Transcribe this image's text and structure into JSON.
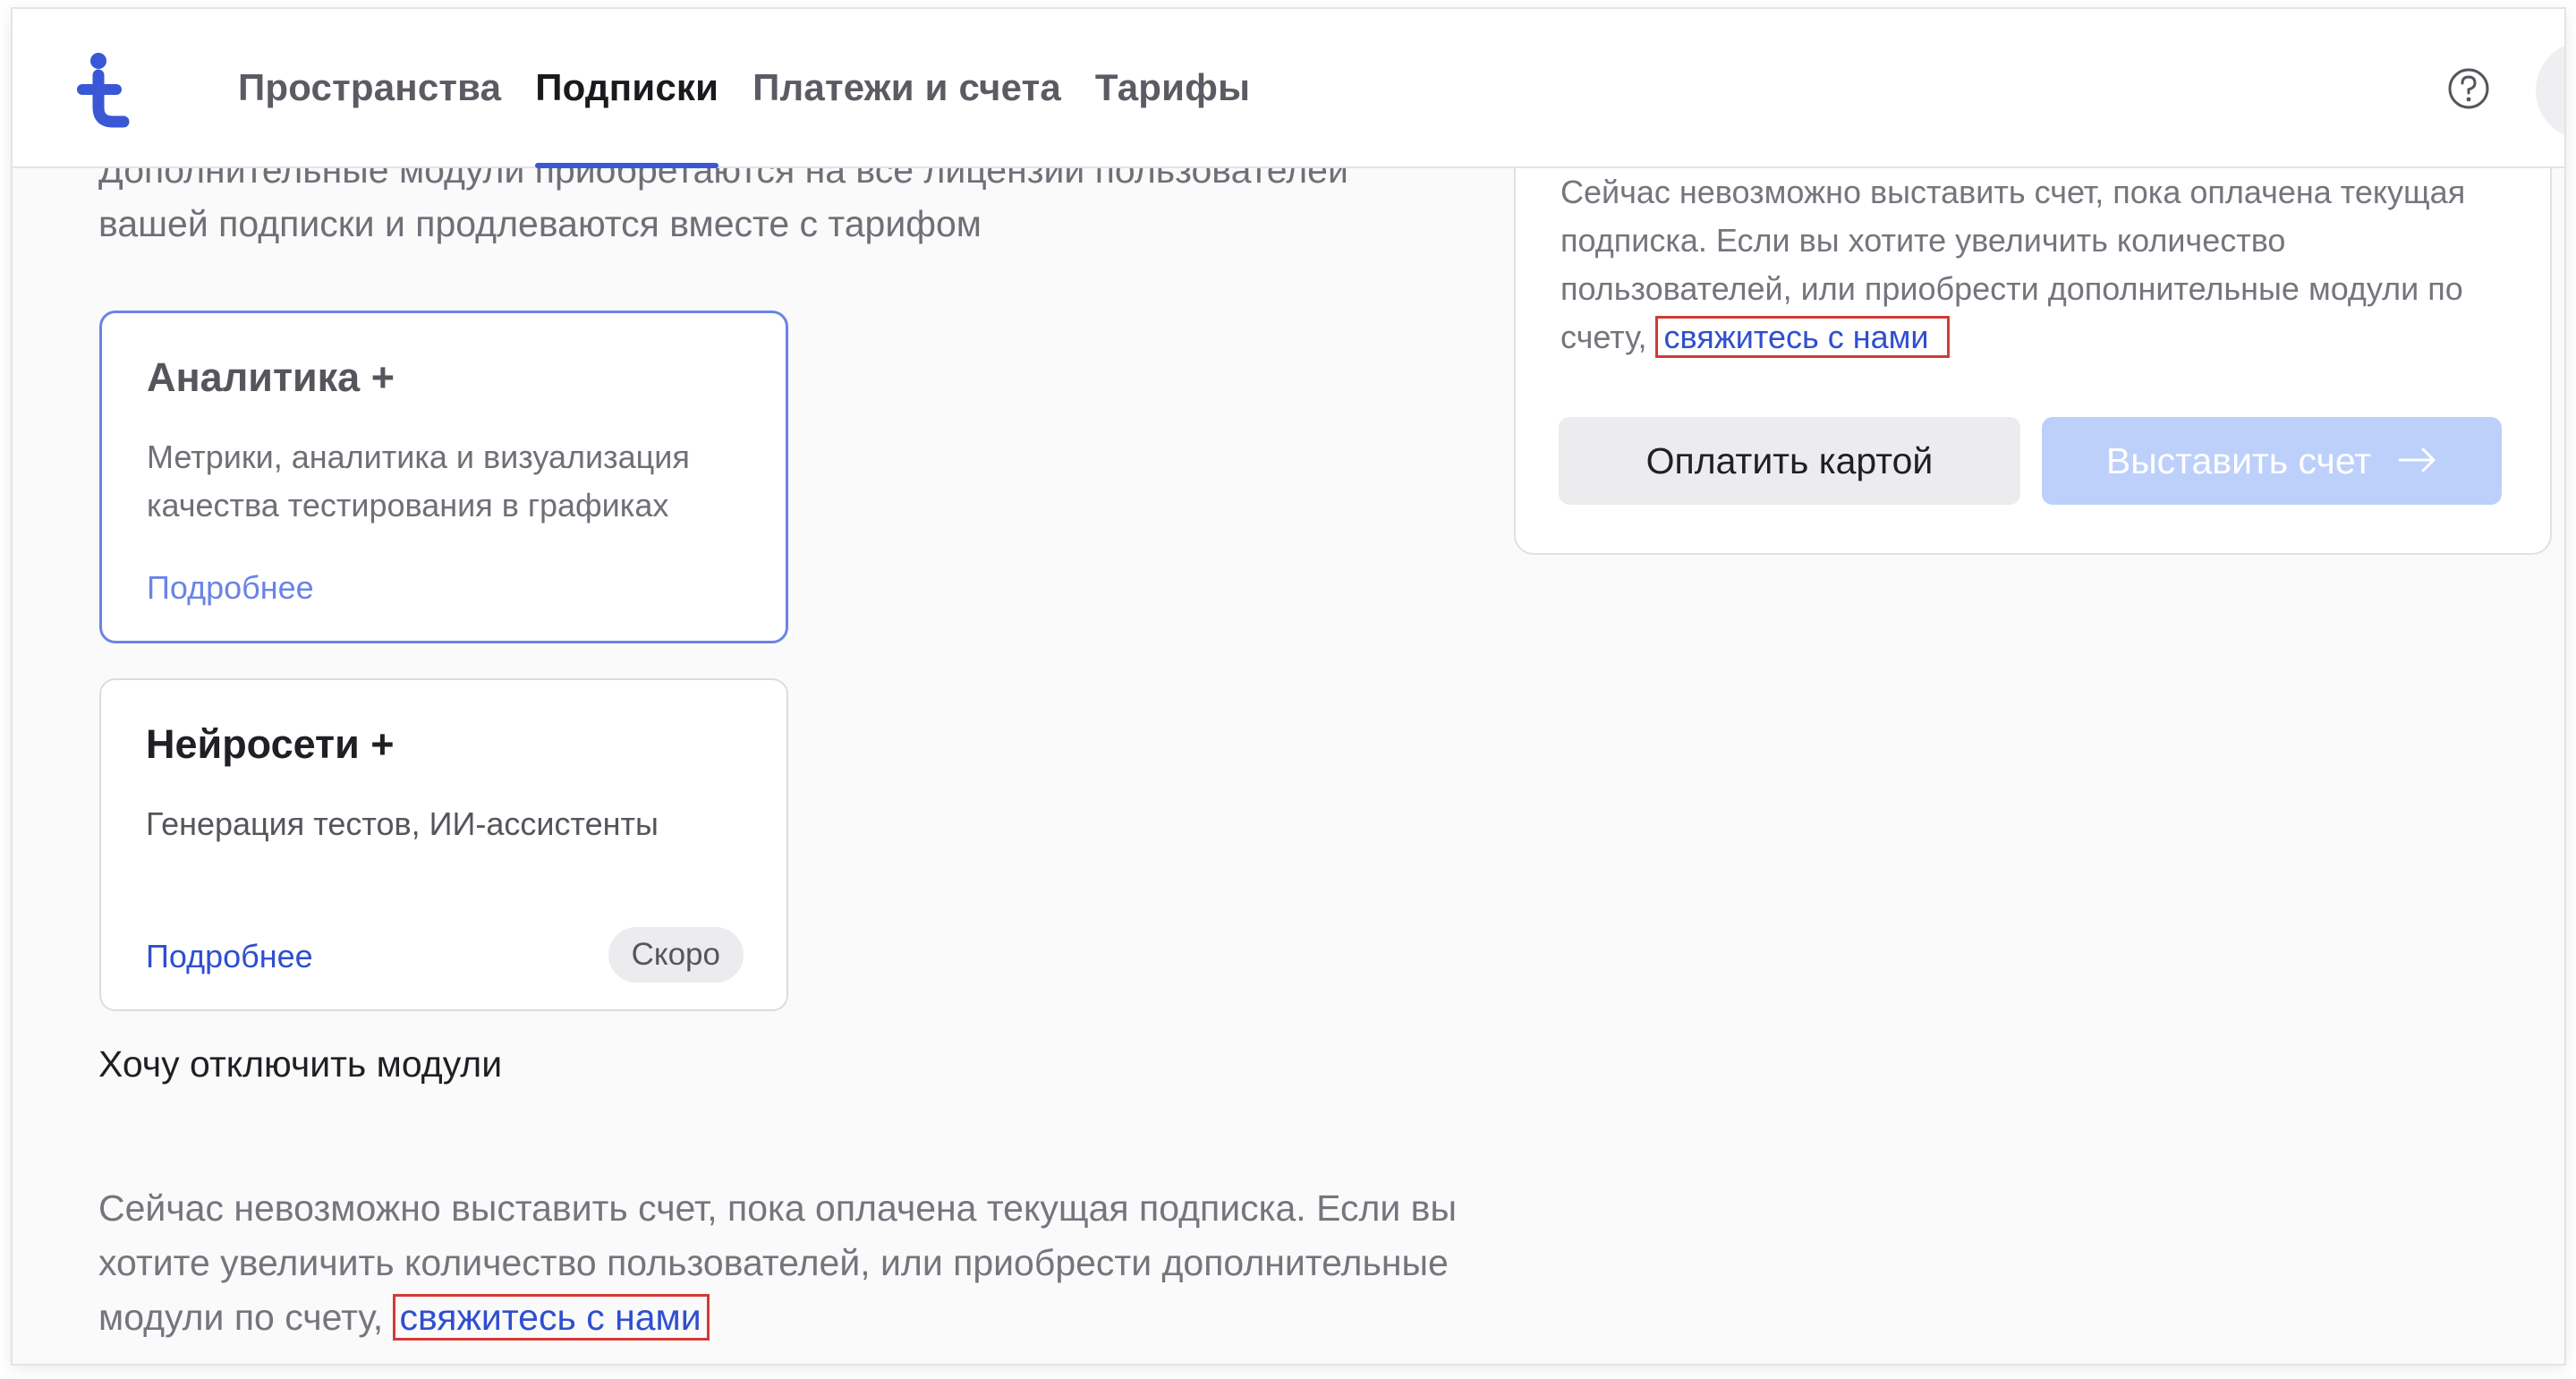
{
  "header": {
    "nav": [
      {
        "label": "Пространства",
        "active": false
      },
      {
        "label": "Подписки",
        "active": true
      },
      {
        "label": "Платежи и счета",
        "active": false
      },
      {
        "label": "Тарифы",
        "active": false
      }
    ],
    "help_icon": "question-circle-icon",
    "logo_icon": "t-logo-icon"
  },
  "modules": {
    "description": "Дополнительные модули приобретаются на все лицензии пользователей вашей подписки и продлеваются вместе с тарифом",
    "cards": [
      {
        "title": "Аналитика +",
        "description": "Метрики, аналитика и визуализация качества тестирования в графиках",
        "link": "Подробнее",
        "selected": true
      },
      {
        "title": "Нейросети +",
        "description": "Генерация тестов, ИИ-ассистенты",
        "link": "Подробнее",
        "badge": "Скоро"
      }
    ],
    "disable_link": "Хочу отключить модули"
  },
  "bottom_note": {
    "text": "Сейчас невозможно выставить счет, пока оплачена текущая подписка. Если вы хотите увеличить количество пользователей, или приобрести дополнительные модули по счету, ",
    "link": "свяжитесь с нами"
  },
  "panel": {
    "note_text": "Сейчас невозможно выставить счет, пока оплачена текущая подписка. Если вы хотите увеличить количество пользователей, или приобрести дополнительные модули по счету, ",
    "note_link": "свяжитесь с нами",
    "pay_card_label": "Оплатить картой",
    "invoice_label": "Выставить счет",
    "invoice_icon": "arrow-right-icon"
  },
  "colors": {
    "accent": "#3a57d6",
    "link": "#2f4fcf",
    "highlight_box": "#d23a35",
    "invoice_disabled": "#bcd0fb"
  }
}
